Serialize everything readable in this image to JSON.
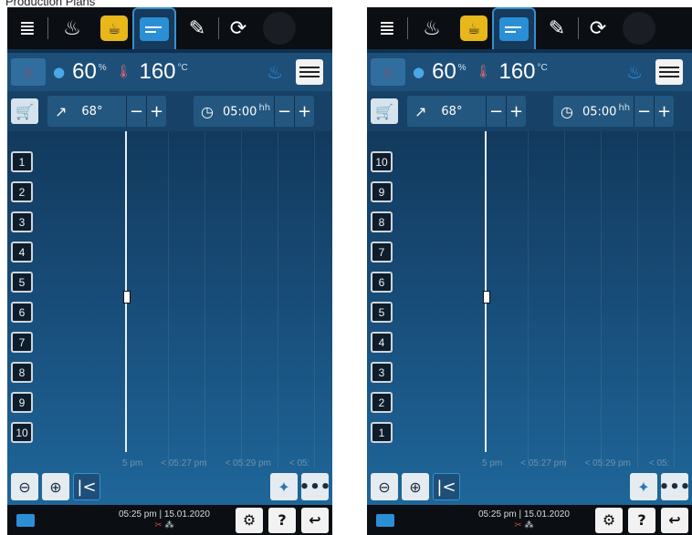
{
  "caption": "Production Plans",
  "panels": [
    {
      "climate": {
        "humidity": "60",
        "humidity_unit": "%",
        "temperature": "160",
        "temperature_unit": "°C"
      },
      "params": {
        "core_temp": "68°",
        "time": "05:00",
        "time_unit": "hh"
      },
      "racks": [
        "1",
        "2",
        "3",
        "4",
        "5",
        "6",
        "7",
        "8",
        "9",
        "10"
      ],
      "time_axis": [
        "5 pm",
        "< 05:27 pm",
        "< 05:29 pm",
        "< 05:"
      ],
      "status": {
        "time": "05:25 pm",
        "date": "15.01.2020"
      }
    },
    {
      "climate": {
        "humidity": "60",
        "humidity_unit": "%",
        "temperature": "160",
        "temperature_unit": "°C"
      },
      "params": {
        "core_temp": "68°",
        "time": "05:00",
        "time_unit": "hh"
      },
      "racks": [
        "10",
        "9",
        "8",
        "7",
        "6",
        "5",
        "4",
        "3",
        "2",
        "1"
      ],
      "time_axis": [
        "5 pm",
        "< 05:27 pm",
        "< 05:29 pm",
        "< 05:"
      ],
      "status": {
        "time": "05:25 pm",
        "date": "15.01.2020"
      }
    }
  ],
  "icons": {
    "menu": "≣",
    "steam": "♨",
    "cook": "☕",
    "edit": "✎",
    "clean": "⟳",
    "cart": "🛒",
    "probe": "↗",
    "timer": "◷",
    "zoom_out": "⊖",
    "zoom_in": "⊕",
    "back": "|<",
    "wash": "✦",
    "more": "•••",
    "gear": "⚙",
    "help": "?",
    "return": "↩"
  }
}
